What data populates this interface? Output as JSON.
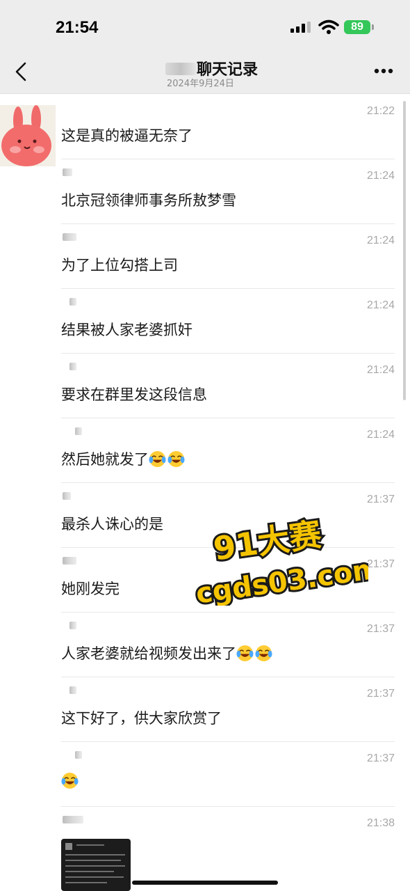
{
  "status": {
    "time": "21:54",
    "battery": "89"
  },
  "nav": {
    "title": "聊天记录",
    "date": "2024年9月24日"
  },
  "messages": [
    {
      "time": "21:22",
      "text": "这是真的被逼无奈了",
      "emoji_count": 0
    },
    {
      "time": "21:24",
      "text": "北京冠领律师事务所敖梦雪",
      "emoji_count": 0
    },
    {
      "time": "21:24",
      "text": "为了上位勾搭上司",
      "emoji_count": 0
    },
    {
      "time": "21:24",
      "text": "结果被人家老婆抓奸",
      "emoji_count": 0
    },
    {
      "time": "21:24",
      "text": "要求在群里发这段信息",
      "emoji_count": 0
    },
    {
      "time": "21:24",
      "text": "然后她就发了",
      "emoji_count": 2
    },
    {
      "time": "21:37",
      "text": "最杀人诛心的是",
      "emoji_count": 0
    },
    {
      "time": "21:37",
      "text": "她刚发完",
      "emoji_count": 0
    },
    {
      "time": "21:37",
      "text": "人家老婆就给视频发出来了",
      "emoji_count": 2
    },
    {
      "time": "21:37",
      "text": "这下好了，供大家欣赏了",
      "emoji_count": 0
    },
    {
      "time": "21:37",
      "text": "",
      "emoji_count": 1
    },
    {
      "time": "21:38",
      "text": "",
      "emoji_count": 0
    }
  ],
  "watermark": {
    "line1": "91大赛",
    "line2": "cgds03.com"
  },
  "icons": {
    "back": "chevron-left-icon",
    "more": "more-dots-icon",
    "emoji": "laughing-crying-face-icon",
    "signal": "cellular-signal-icon",
    "wifi": "wifi-icon",
    "battery": "battery-icon"
  },
  "colors": {
    "battery": "#34c759",
    "watermark_fill": "#f5c400",
    "bar_bg": "#ededed"
  }
}
